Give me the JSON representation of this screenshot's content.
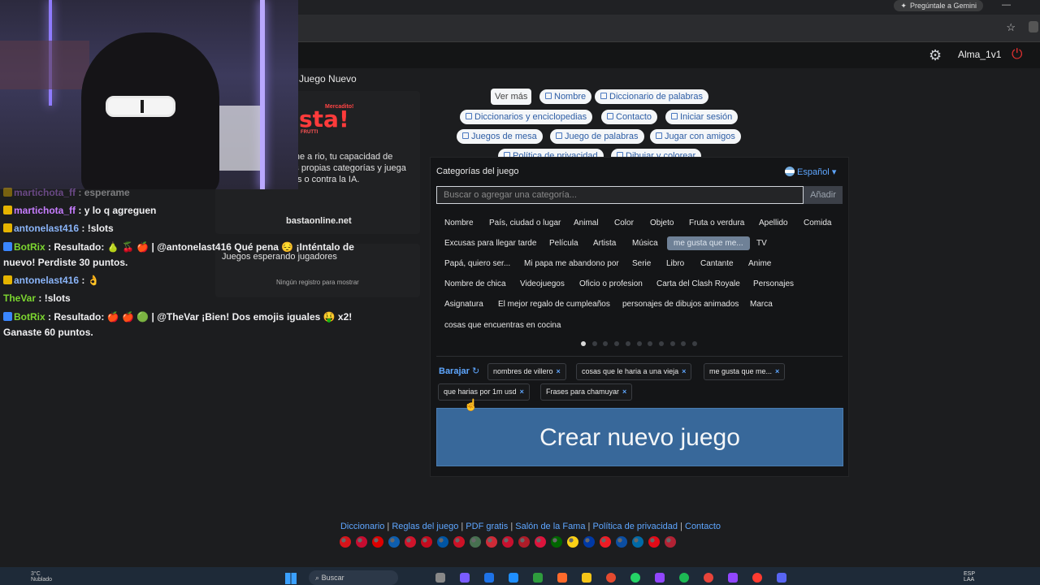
{
  "browser": {
    "gemini_label": "Pregúntale a Gemini",
    "min_label": "—"
  },
  "header": {
    "username": "Alma_1v1"
  },
  "chat": {
    "messages": [
      {
        "user": "martichota_ff",
        "sep": " : ",
        "text": "esperame",
        "color": "#c77dff",
        "badge_color": "#e5b400"
      },
      {
        "user": "martichota_ff",
        "sep": " : ",
        "text": "y lo q agreguen",
        "color": "#c77dff",
        "badge_color": "#e5b400"
      },
      {
        "user": "antonelast416",
        "sep": " : ",
        "text": "!slots",
        "color": "#8ab4f8",
        "badge_color": "#e5b400"
      },
      {
        "user": "BotRix",
        "sep": " : ",
        "text": "Resultado: 🍐 🍒 🍎 | @antonelast416 Qué pena 😔 ¡Inténtalo de nuevo! Perdiste 30 puntos.",
        "color": "#7cd630",
        "badge_color": "#3a86ff"
      },
      {
        "user": "antonelast416",
        "sep": " : ",
        "text": "👌",
        "color": "#8ab4f8",
        "badge_color": "#e5b400"
      },
      {
        "user": "TheVar",
        "sep": " : ",
        "text": "!slots",
        "color": "#7cd630",
        "badge_color": ""
      },
      {
        "user": "BotRix",
        "sep": " : ",
        "text": "Resultado: 🍎 🍎 🟢 | @TheVar ¡Bien! Dos emojis iguales 🤑 x2! Ganaste 60 puntos.",
        "color": "#7cd630",
        "badge_color": "#3a86ff"
      }
    ]
  },
  "left": {
    "heading": "Juego Nuevo",
    "logo_small": "Mercadito!",
    "logo_big": "sta!",
    "logo_sub": "FRUTTI",
    "description": "as creativo que pone a rio, tu capacidad de aginación. Crea tus propias categorías y juega en línea con amigos o contra la IA.",
    "site": "bastaonline.net",
    "waiting": "Juegos esperando jugadores",
    "no_records": "Ningún registro para mostrar"
  },
  "tags": {
    "ver_mas": "Ver más",
    "items": [
      "Nombre",
      "Diccionario de palabras",
      "Diccionarios y enciclopedias",
      "Contacto",
      "Iniciar sesión",
      "Juegos de mesa",
      "Juego de palabras",
      "Jugar con amigos",
      "Política de privacidad",
      "Dibujar y colorear"
    ]
  },
  "game": {
    "title": "Categorías del juego",
    "language": "Español",
    "search_placeholder": "Buscar o agregar una categoría...",
    "add_label": "Añadir",
    "categories": [
      "Nombre",
      "País, ciudad o lugar",
      "Animal",
      "Color",
      "Objeto",
      "Fruta o verdura",
      "Apellido",
      "Comida",
      "Excusas para llegar tarde",
      "Película",
      "Artista",
      "Música",
      "me gusta que me...",
      "TV",
      "Papá, quiero ser...",
      "Mi papa me abandono por",
      "Serie",
      "Libro",
      "Cantante",
      "Anime",
      "Nombre de chica",
      "Videojuegos",
      "Oficio o profesion",
      "Carta del Clash Royale",
      "Personajes",
      "Asignatura",
      "El mejor regalo de cumpleaños",
      "personajes de dibujos animados",
      "Marca",
      "cosas que encuentras en cocina"
    ],
    "page_count": 11,
    "current_page": 1,
    "shuffle_label": "Barajar",
    "selected": [
      "nombres de villero",
      "cosas que le haria a una vieja",
      "me gusta que me...",
      "que harias por 1m usd",
      "Frases para chamuyar"
    ],
    "create_label": "Crear nuevo juego"
  },
  "footer": {
    "links": [
      "Diccionario",
      "Reglas del juego",
      "PDF gratis",
      "Salón de la Fama",
      "Política de privacidad",
      "Contacto"
    ],
    "flag_colors": [
      "#d7141a",
      "#c60c30",
      "#dd0000",
      "#0d5eaf",
      "#cf142b",
      "#c60b1e",
      "#0055a4",
      "#cd1126",
      "#477050",
      "#ce2b37",
      "#c8102e",
      "#ae1c28",
      "#dc143c",
      "#006600",
      "#fcd116",
      "#0039a6",
      "#ee1c25",
      "#0b4ea2",
      "#006aa7",
      "#e30a17",
      "#b22234"
    ]
  },
  "taskbar": {
    "temp": "3°C",
    "weather": "Nublado",
    "search_label": "Buscar",
    "lang1": "ESP",
    "lang2": "LAA"
  }
}
